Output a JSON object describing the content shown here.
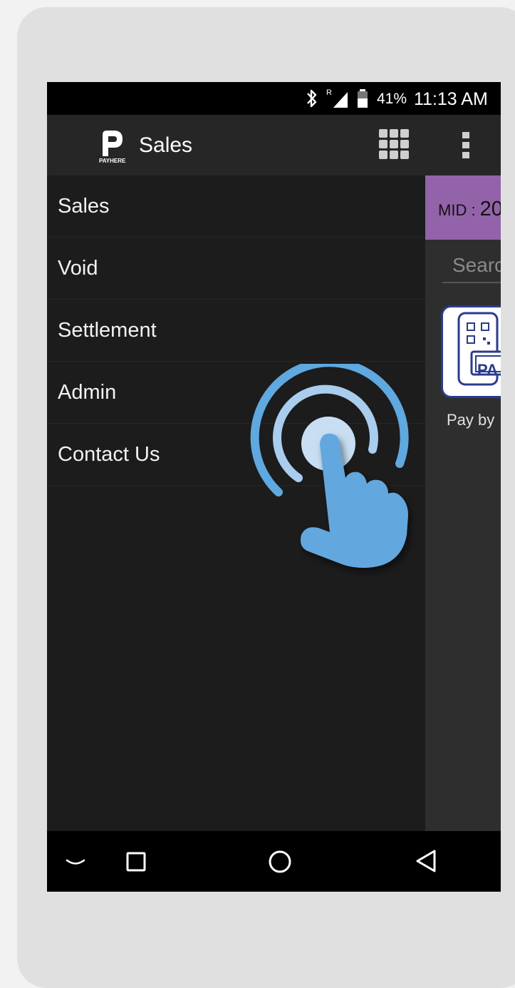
{
  "status_bar": {
    "battery_percent": "41%",
    "time": "11:13 AM",
    "icons": [
      "bluetooth-icon",
      "signal-roaming-icon",
      "battery-icon"
    ]
  },
  "app_bar": {
    "logo_text": "PAYHERE",
    "title": "Sales",
    "icons": [
      "grid-menu-icon",
      "more-vert-icon"
    ]
  },
  "drawer": {
    "items": [
      {
        "label": "Sales"
      },
      {
        "label": "Void"
      },
      {
        "label": "Settlement"
      },
      {
        "label": "Admin"
      },
      {
        "label": "Contact Us"
      }
    ]
  },
  "content": {
    "mid_label": "MID : ",
    "mid_value": "20",
    "search_placeholder": "Search",
    "tile_text": "PA",
    "tile_label": "Pay by"
  },
  "nav_bar": {
    "icons": [
      "chevron-down-icon",
      "recent-apps-icon",
      "home-icon",
      "back-icon"
    ]
  },
  "colors": {
    "accent_purple": "#9363a9",
    "touch_blue": "#5fa8e0",
    "drawer_bg": "#1c1c1c",
    "app_bar_bg": "#262626",
    "tile_border": "#2a3b8e"
  }
}
